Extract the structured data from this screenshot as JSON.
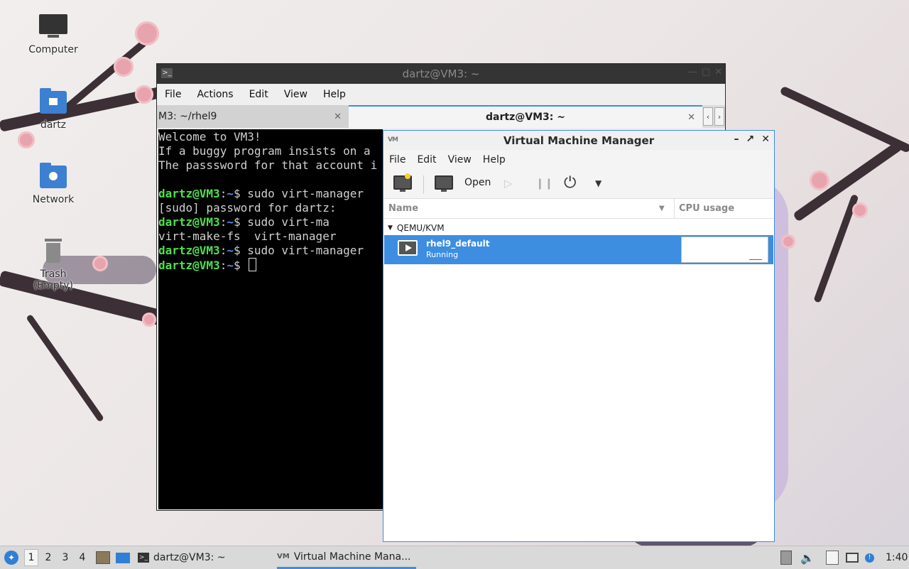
{
  "desktop": {
    "icons": [
      {
        "label": "Computer"
      },
      {
        "label": "dartz"
      },
      {
        "label": "Network"
      },
      {
        "label": "Trash (Empty)"
      }
    ]
  },
  "terminal": {
    "title": "dartz@VM3: ~",
    "menu": [
      "File",
      "Actions",
      "Edit",
      "View",
      "Help"
    ],
    "tabs": [
      {
        "label": "M3: ~/rhel9"
      },
      {
        "label": "dartz@VM3: ~"
      }
    ],
    "lines": [
      {
        "type": "text",
        "text": "Welcome to VM3!"
      },
      {
        "type": "text",
        "text": "If a buggy program insists on a"
      },
      {
        "type": "text",
        "text": "The passsword for that account i"
      },
      {
        "type": "text",
        "text": ""
      },
      {
        "type": "prompt",
        "user": "dartz@VM3",
        "path": "~",
        "cmd": "$ sudo virt-manager"
      },
      {
        "type": "text",
        "text": "[sudo] password for dartz:"
      },
      {
        "type": "prompt",
        "user": "dartz@VM3",
        "path": "~",
        "cmd": "$ sudo virt-ma"
      },
      {
        "type": "text",
        "text": "virt-make-fs  virt-manager"
      },
      {
        "type": "prompt",
        "user": "dartz@VM3",
        "path": "~",
        "cmd": "$ sudo virt-manager"
      },
      {
        "type": "prompt",
        "user": "dartz@VM3",
        "path": "~",
        "cmd": "$ ",
        "cursor": true
      }
    ]
  },
  "vmm": {
    "title": "Virtual Machine Manager",
    "menu": [
      "File",
      "Edit",
      "View",
      "Help"
    ],
    "toolbar": {
      "open_label": "Open"
    },
    "columns": {
      "name": "Name",
      "cpu": "CPU usage"
    },
    "group": "QEMU/KVM",
    "vm": {
      "name": "rhel9_default",
      "status": "Running"
    }
  },
  "taskbar": {
    "workspaces": [
      "1",
      "2",
      "3",
      "4"
    ],
    "active_workspace": "1",
    "tasks": [
      {
        "label": "dartz@VM3: ~"
      },
      {
        "label": "Virtual Machine Mana..."
      }
    ],
    "clock": "1:40"
  },
  "colors": {
    "accent": "#3d8ee0",
    "prompt_user": "#4fe04f",
    "prompt_path": "#5c8cf0"
  }
}
